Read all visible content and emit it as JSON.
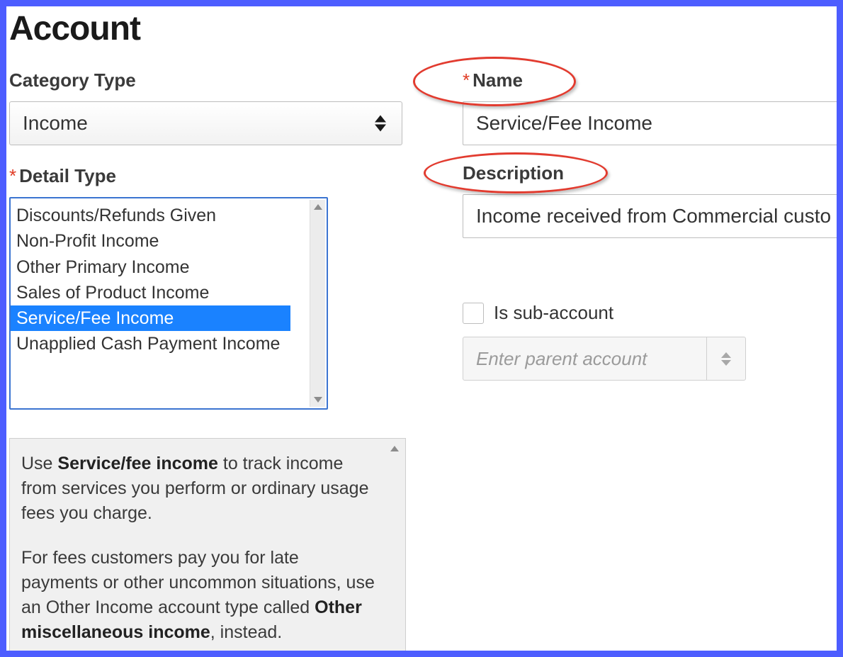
{
  "page_title": "Account",
  "left": {
    "category_type_label": "Category Type",
    "category_type_value": "Income",
    "detail_type_label": "Detail Type",
    "detail_type_options": [
      "Discounts/Refunds Given",
      "Non-Profit Income",
      "Other Primary Income",
      "Sales of Product Income",
      "Service/Fee Income",
      "Unapplied Cash Payment Income"
    ],
    "detail_type_selected_index": 4,
    "help_p1_pre": "Use ",
    "help_p1_bold": "Service/fee income",
    "help_p1_post": " to track income from services you perform or ordinary usage fees you charge.",
    "help_p2_pre": "For fees customers pay you for late payments or other uncommon situations, use an Other Income account type called ",
    "help_p2_bold": "Other miscellaneous income",
    "help_p2_post": ", instead."
  },
  "right": {
    "name_label": "Name",
    "name_value": "Service/Fee Income",
    "description_label": "Description",
    "description_value": "Income received from Commercial custo",
    "is_subaccount_label": "Is sub-account",
    "parent_placeholder": "Enter parent account"
  }
}
